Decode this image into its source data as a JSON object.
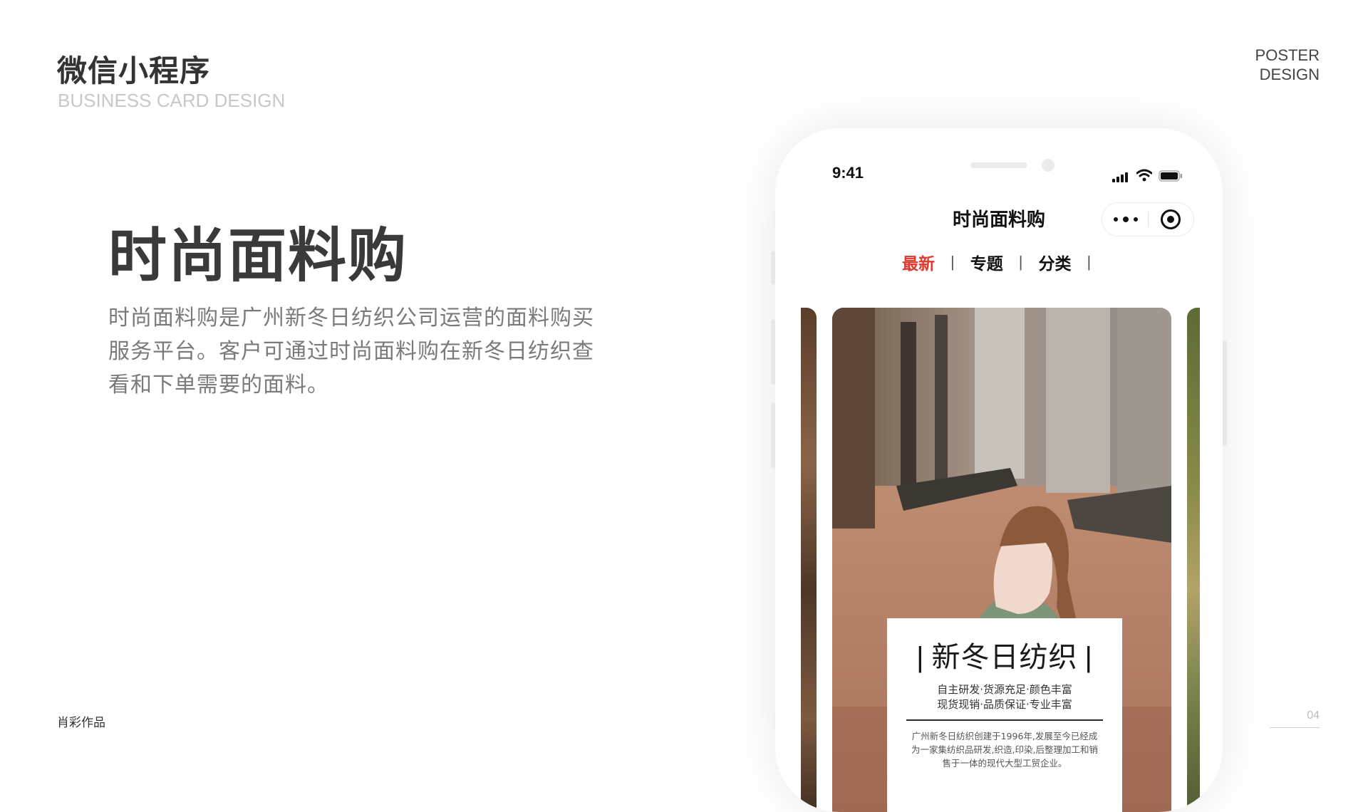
{
  "header": {
    "title": "微信小程序",
    "subtitle": "BUSINESS CARD DESIGN",
    "corner_label_line1": "POSTER",
    "corner_label_line2": "DESIGN"
  },
  "main": {
    "title": "时尚面料购",
    "description": "时尚面料购是广州新冬日纺织公司运营的面料购买服务平台。客户可通过时尚面料购在新冬日纺织查看和下单需要的面料。"
  },
  "footer": {
    "author": "肖彩作品",
    "page_number": "04"
  },
  "phone": {
    "status_time": "9:41",
    "nav_title": "时尚面料购",
    "icons": [
      "signal-icon",
      "wifi-icon",
      "battery-icon",
      "more-icon",
      "close-icon"
    ],
    "tabs": [
      {
        "label": "最新",
        "active": true
      },
      {
        "label": "专题",
        "active": false
      },
      {
        "label": "分类",
        "active": false
      }
    ],
    "tab_separator": "|",
    "poster": {
      "title": "新冬日纺织",
      "bar": "|",
      "tagline_line1": "自主研发·货源充足·颜色丰富",
      "tagline_line2": "现货现销·品质保证·专业丰富",
      "body_line1": "广州新冬日纺织创建于1996年,发展至今已经成",
      "body_line2": "为一家集纺织品研发,织造,印染,后整理加工和销",
      "body_line3": "售于一体的现代大型工贸企业。"
    }
  },
  "colors": {
    "accent": "#e0392f",
    "text_dark": "#333333",
    "text_muted": "#7a7a7a",
    "subtitle_gray": "#c8c8c8"
  }
}
